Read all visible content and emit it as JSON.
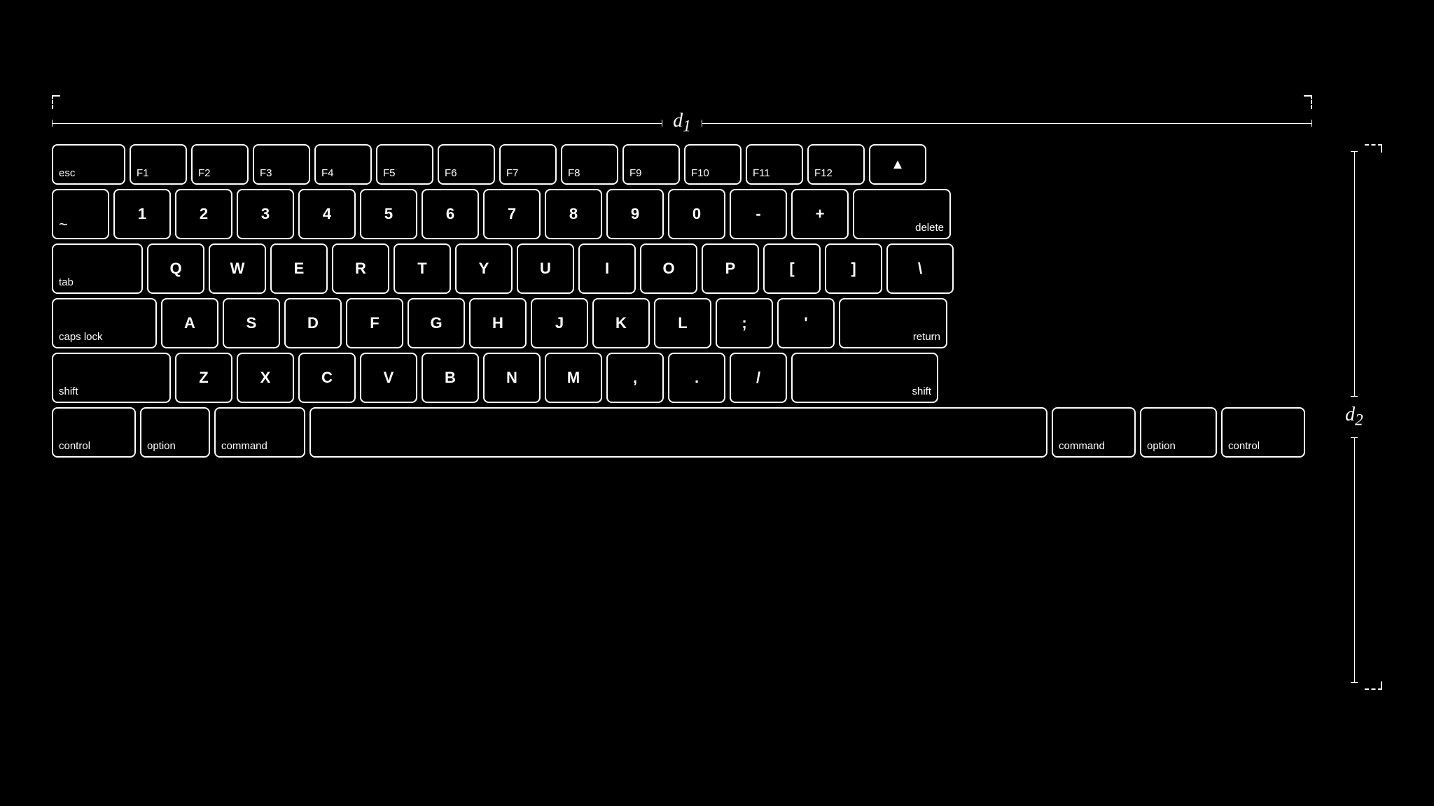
{
  "dimensions": {
    "d1_label": "d",
    "d1_sub": "1",
    "d2_label": "d",
    "d2_sub": "2"
  },
  "keyboard": {
    "rows": [
      {
        "id": "fn-row",
        "keys": [
          {
            "id": "esc",
            "label": "esc",
            "type": "esc"
          },
          {
            "id": "f1",
            "label": "F1",
            "type": "fn"
          },
          {
            "id": "f2",
            "label": "F2",
            "type": "fn"
          },
          {
            "id": "f3",
            "label": "F3",
            "type": "fn"
          },
          {
            "id": "f4",
            "label": "F4",
            "type": "fn"
          },
          {
            "id": "f5",
            "label": "F5",
            "type": "fn"
          },
          {
            "id": "f6",
            "label": "F6",
            "type": "fn"
          },
          {
            "id": "f7",
            "label": "F7",
            "type": "fn"
          },
          {
            "id": "f8",
            "label": "F8",
            "type": "fn"
          },
          {
            "id": "f9",
            "label": "F9",
            "type": "fn"
          },
          {
            "id": "f10",
            "label": "F10",
            "type": "fn"
          },
          {
            "id": "f11",
            "label": "F11",
            "type": "fn"
          },
          {
            "id": "f12",
            "label": "F12",
            "type": "fn"
          },
          {
            "id": "eject",
            "label": "⏏",
            "type": "eject"
          }
        ]
      },
      {
        "id": "num-row",
        "keys": [
          {
            "id": "tilde",
            "label": "~",
            "type": "num"
          },
          {
            "id": "1",
            "label": "1",
            "type": "num"
          },
          {
            "id": "2",
            "label": "2",
            "type": "num"
          },
          {
            "id": "3",
            "label": "3",
            "type": "num"
          },
          {
            "id": "4",
            "label": "4",
            "type": "num"
          },
          {
            "id": "5",
            "label": "5",
            "type": "num"
          },
          {
            "id": "6",
            "label": "6",
            "type": "num"
          },
          {
            "id": "7",
            "label": "7",
            "type": "num"
          },
          {
            "id": "8",
            "label": "8",
            "type": "num"
          },
          {
            "id": "9",
            "label": "9",
            "type": "num"
          },
          {
            "id": "0",
            "label": "0",
            "type": "num"
          },
          {
            "id": "minus",
            "label": "-",
            "type": "num"
          },
          {
            "id": "plus",
            "label": "+",
            "type": "num"
          },
          {
            "id": "delete",
            "label": "delete",
            "type": "delete"
          }
        ]
      },
      {
        "id": "qwerty-row",
        "keys": [
          {
            "id": "tab",
            "label": "tab",
            "type": "tab"
          },
          {
            "id": "q",
            "label": "Q",
            "type": "letter"
          },
          {
            "id": "w",
            "label": "W",
            "type": "letter"
          },
          {
            "id": "e",
            "label": "E",
            "type": "letter"
          },
          {
            "id": "r",
            "label": "R",
            "type": "letter"
          },
          {
            "id": "t",
            "label": "T",
            "type": "letter"
          },
          {
            "id": "y",
            "label": "Y",
            "type": "letter"
          },
          {
            "id": "u",
            "label": "U",
            "type": "letter"
          },
          {
            "id": "i",
            "label": "I",
            "type": "letter"
          },
          {
            "id": "o",
            "label": "O",
            "type": "letter"
          },
          {
            "id": "p",
            "label": "P",
            "type": "letter"
          },
          {
            "id": "lbracket",
            "label": "[",
            "type": "letter"
          },
          {
            "id": "rbracket",
            "label": "]",
            "type": "letter"
          },
          {
            "id": "backslash",
            "label": "\\",
            "type": "backslash"
          }
        ]
      },
      {
        "id": "home-row",
        "keys": [
          {
            "id": "capslock",
            "label": "caps lock",
            "type": "capslock"
          },
          {
            "id": "a",
            "label": "A",
            "type": "letter"
          },
          {
            "id": "s",
            "label": "S",
            "type": "letter"
          },
          {
            "id": "d",
            "label": "D",
            "type": "letter"
          },
          {
            "id": "f",
            "label": "F",
            "type": "letter"
          },
          {
            "id": "g",
            "label": "G",
            "type": "letter"
          },
          {
            "id": "h",
            "label": "H",
            "type": "letter"
          },
          {
            "id": "j",
            "label": "J",
            "type": "letter"
          },
          {
            "id": "k",
            "label": "K",
            "type": "letter"
          },
          {
            "id": "l",
            "label": "L",
            "type": "letter"
          },
          {
            "id": "semicolon",
            "label": ";",
            "type": "letter"
          },
          {
            "id": "quote",
            "label": "'",
            "type": "letter"
          },
          {
            "id": "return",
            "label": "return",
            "type": "return"
          }
        ]
      },
      {
        "id": "shift-row",
        "keys": [
          {
            "id": "shift-l",
            "label": "shift",
            "type": "shift-l"
          },
          {
            "id": "z",
            "label": "Z",
            "type": "letter"
          },
          {
            "id": "x",
            "label": "X",
            "type": "letter"
          },
          {
            "id": "c",
            "label": "C",
            "type": "letter"
          },
          {
            "id": "v",
            "label": "V",
            "type": "letter"
          },
          {
            "id": "b",
            "label": "B",
            "type": "letter"
          },
          {
            "id": "n",
            "label": "N",
            "type": "letter"
          },
          {
            "id": "m",
            "label": "M",
            "type": "letter"
          },
          {
            "id": "comma",
            "label": ",",
            "type": "letter"
          },
          {
            "id": "period",
            "label": ".",
            "type": "letter"
          },
          {
            "id": "slash",
            "label": "/",
            "type": "letter"
          },
          {
            "id": "shift-r",
            "label": "shift",
            "type": "shift-r"
          }
        ]
      },
      {
        "id": "bottom-row",
        "keys": [
          {
            "id": "control-l",
            "label": "control",
            "type": "control"
          },
          {
            "id": "option-l",
            "label": "option",
            "type": "option"
          },
          {
            "id": "command-l",
            "label": "command",
            "type": "command"
          },
          {
            "id": "space",
            "label": "",
            "type": "space"
          },
          {
            "id": "command-r",
            "label": "command",
            "type": "command-r"
          },
          {
            "id": "option-r",
            "label": "option",
            "type": "option-r"
          },
          {
            "id": "control-r",
            "label": "control",
            "type": "control-r"
          }
        ]
      }
    ]
  }
}
